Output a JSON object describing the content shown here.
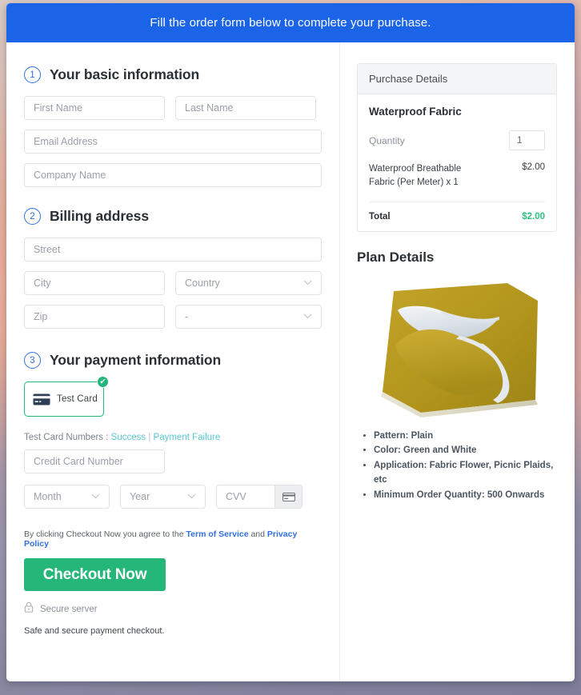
{
  "banner": {
    "text": "Fill the order form below to complete your purchase."
  },
  "steps": [
    {
      "num": "1",
      "title": "Your basic information"
    },
    {
      "num": "2",
      "title": "Billing address"
    },
    {
      "num": "3",
      "title": "Your payment information"
    }
  ],
  "basic": {
    "first_name": "First Name",
    "last_name": "Last Name",
    "email": "Email Address",
    "company": "Company Name"
  },
  "billing": {
    "street": "Street",
    "city": "City",
    "country": "Country",
    "zip": "Zip",
    "state": "-",
    "chevron": "chevron-down-icon"
  },
  "payment": {
    "tile_label": "Test  Card",
    "tile_check": "✔",
    "test_prefix": "Test Card Numbers :",
    "link_success": "Success",
    "link_separator": "|",
    "link_failure": "Payment Failure",
    "card_number": "Credit Card Number",
    "month": "Month",
    "year": "Year",
    "cvv": "CVV"
  },
  "footer": {
    "terms_pre": "By clicking Checkout Now you agree to the",
    "terms_link1": "Term of Service",
    "terms_mid": "and",
    "terms_link2": "Privacy Policy",
    "checkout_label": "Checkout Now",
    "secure_label": "Secure server",
    "safe_label": "Safe and secure payment checkout."
  },
  "purchase": {
    "header": "Purchase Details",
    "product": "Waterproof Fabric",
    "quantity_label": "Quantity",
    "quantity_value": "1",
    "line_desc": "Waterproof Breathable Fabric (Per Meter) x 1",
    "line_amount": "$2.00",
    "total_label": "Total",
    "total_amount": "$2.00"
  },
  "plan": {
    "title": "Plan Details",
    "image_alt": "waterproof-fabric-photo",
    "specs": [
      "Pattern: Plain",
      "Color: Green and White",
      "Application: Fabric Flower, Picnic Plaids, etc",
      "Minimum Order Quantity: 500 Onwards"
    ]
  },
  "colors": {
    "banner_blue": "#1b64e8",
    "accent_green": "#25b77a",
    "total_green": "#2ec27e",
    "link_blue": "#2f6fe0",
    "link_teal": "#57c6cf",
    "fabric_yellow": "#b79b1f"
  }
}
